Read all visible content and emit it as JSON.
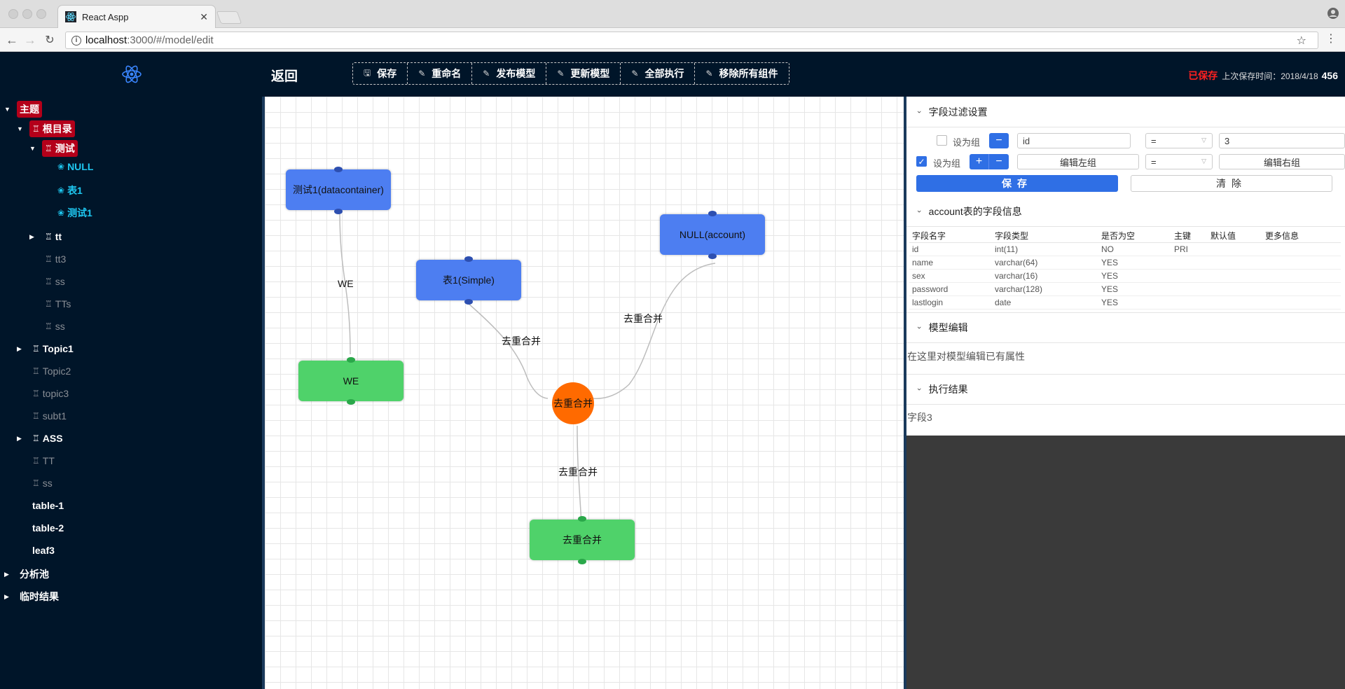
{
  "browser": {
    "tab_title": "React Aspp",
    "url_host": "localhost",
    "url_path": ":3000/#/model/edit"
  },
  "header": {
    "back": "返回",
    "toolbar": [
      {
        "label": "保存",
        "icon": "save-icon"
      },
      {
        "label": "重命名",
        "icon": "edit-icon"
      },
      {
        "label": "发布模型",
        "icon": "edit-icon"
      },
      {
        "label": "更新模型",
        "icon": "edit-icon"
      },
      {
        "label": "全部执行",
        "icon": "edit-icon"
      },
      {
        "label": "移除所有组件",
        "icon": "edit-icon"
      }
    ],
    "status_saved": "已保存",
    "status_time": "上次保存时间：2018/4/18",
    "status_num": "456"
  },
  "tree": {
    "root": "主题",
    "n_genmulu": "根目录",
    "n_ceshi": "测试",
    "n_null": "NULL",
    "n_biao1": "表1",
    "n_ceshi1": "测试1",
    "n_tt": "tt",
    "n_tt3": "tt3",
    "n_ss1": "ss",
    "n_TTs": "TTs",
    "n_ss2": "ss",
    "n_topic1": "Topic1",
    "n_topic2": "Topic2",
    "n_topic3": "topic3",
    "n_subt1": "subt1",
    "n_ass": "ASS",
    "n_TT": "TT",
    "n_ss3": "ss",
    "n_table1": "table-1",
    "n_table2": "table-2",
    "n_leaf3": "leaf3",
    "n_fenxichi": "分析池",
    "n_linshi": "临时结果"
  },
  "canvas": {
    "node_ceshi1": "测试1(datacontainer)",
    "node_we": "WE",
    "node_biao1": "表1(Simple)",
    "node_null": "NULL(account)",
    "node_merge_circle": "去重合并",
    "node_merge_out": "去重合并",
    "edge_we": "WE",
    "edge_left": "去重合并",
    "edge_right": "去重合并",
    "edge_bottom": "去重合并"
  },
  "panel": {
    "filter_title": "字段过滤设置",
    "row1": {
      "group_label": "设为组",
      "field": "id",
      "op": "=",
      "value": "3",
      "checked": false
    },
    "row2": {
      "group_label": "设为组",
      "left": "编辑左组",
      "op": "=",
      "right": "编辑右组",
      "checked": true
    },
    "save": "保存",
    "clear": "清除",
    "fields_title": "account表的字段信息",
    "table_headers": [
      "字段名字",
      "字段类型",
      "是否为空",
      "主键",
      "默认值",
      "更多信息"
    ],
    "table_rows": [
      [
        "id",
        "int(11)",
        "NO",
        "PRI",
        "",
        ""
      ],
      [
        "name",
        "varchar(64)",
        "YES",
        "",
        "",
        ""
      ],
      [
        "sex",
        "varchar(16)",
        "YES",
        "",
        "",
        ""
      ],
      [
        "password",
        "varchar(128)",
        "YES",
        "",
        "",
        ""
      ],
      [
        "lastlogin",
        "date",
        "YES",
        "",
        "",
        ""
      ]
    ],
    "model_title": "模型编辑",
    "model_text": "在这里对模型编辑已有属性",
    "result_title": "执行结果",
    "result_text": "字段3"
  }
}
